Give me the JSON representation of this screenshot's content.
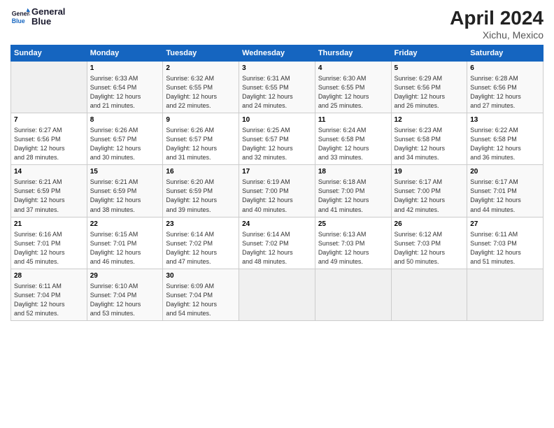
{
  "header": {
    "logo_line1": "General",
    "logo_line2": "Blue",
    "title": "April 2024",
    "subtitle": "Xichu, Mexico"
  },
  "columns": [
    "Sunday",
    "Monday",
    "Tuesday",
    "Wednesday",
    "Thursday",
    "Friday",
    "Saturday"
  ],
  "weeks": [
    [
      {
        "day": "",
        "info": ""
      },
      {
        "day": "1",
        "info": "Sunrise: 6:33 AM\nSunset: 6:54 PM\nDaylight: 12 hours\nand 21 minutes."
      },
      {
        "day": "2",
        "info": "Sunrise: 6:32 AM\nSunset: 6:55 PM\nDaylight: 12 hours\nand 22 minutes."
      },
      {
        "day": "3",
        "info": "Sunrise: 6:31 AM\nSunset: 6:55 PM\nDaylight: 12 hours\nand 24 minutes."
      },
      {
        "day": "4",
        "info": "Sunrise: 6:30 AM\nSunset: 6:55 PM\nDaylight: 12 hours\nand 25 minutes."
      },
      {
        "day": "5",
        "info": "Sunrise: 6:29 AM\nSunset: 6:56 PM\nDaylight: 12 hours\nand 26 minutes."
      },
      {
        "day": "6",
        "info": "Sunrise: 6:28 AM\nSunset: 6:56 PM\nDaylight: 12 hours\nand 27 minutes."
      }
    ],
    [
      {
        "day": "7",
        "info": "Sunrise: 6:27 AM\nSunset: 6:56 PM\nDaylight: 12 hours\nand 28 minutes."
      },
      {
        "day": "8",
        "info": "Sunrise: 6:26 AM\nSunset: 6:57 PM\nDaylight: 12 hours\nand 30 minutes."
      },
      {
        "day": "9",
        "info": "Sunrise: 6:26 AM\nSunset: 6:57 PM\nDaylight: 12 hours\nand 31 minutes."
      },
      {
        "day": "10",
        "info": "Sunrise: 6:25 AM\nSunset: 6:57 PM\nDaylight: 12 hours\nand 32 minutes."
      },
      {
        "day": "11",
        "info": "Sunrise: 6:24 AM\nSunset: 6:58 PM\nDaylight: 12 hours\nand 33 minutes."
      },
      {
        "day": "12",
        "info": "Sunrise: 6:23 AM\nSunset: 6:58 PM\nDaylight: 12 hours\nand 34 minutes."
      },
      {
        "day": "13",
        "info": "Sunrise: 6:22 AM\nSunset: 6:58 PM\nDaylight: 12 hours\nand 36 minutes."
      }
    ],
    [
      {
        "day": "14",
        "info": "Sunrise: 6:21 AM\nSunset: 6:59 PM\nDaylight: 12 hours\nand 37 minutes."
      },
      {
        "day": "15",
        "info": "Sunrise: 6:21 AM\nSunset: 6:59 PM\nDaylight: 12 hours\nand 38 minutes."
      },
      {
        "day": "16",
        "info": "Sunrise: 6:20 AM\nSunset: 6:59 PM\nDaylight: 12 hours\nand 39 minutes."
      },
      {
        "day": "17",
        "info": "Sunrise: 6:19 AM\nSunset: 7:00 PM\nDaylight: 12 hours\nand 40 minutes."
      },
      {
        "day": "18",
        "info": "Sunrise: 6:18 AM\nSunset: 7:00 PM\nDaylight: 12 hours\nand 41 minutes."
      },
      {
        "day": "19",
        "info": "Sunrise: 6:17 AM\nSunset: 7:00 PM\nDaylight: 12 hours\nand 42 minutes."
      },
      {
        "day": "20",
        "info": "Sunrise: 6:17 AM\nSunset: 7:01 PM\nDaylight: 12 hours\nand 44 minutes."
      }
    ],
    [
      {
        "day": "21",
        "info": "Sunrise: 6:16 AM\nSunset: 7:01 PM\nDaylight: 12 hours\nand 45 minutes."
      },
      {
        "day": "22",
        "info": "Sunrise: 6:15 AM\nSunset: 7:01 PM\nDaylight: 12 hours\nand 46 minutes."
      },
      {
        "day": "23",
        "info": "Sunrise: 6:14 AM\nSunset: 7:02 PM\nDaylight: 12 hours\nand 47 minutes."
      },
      {
        "day": "24",
        "info": "Sunrise: 6:14 AM\nSunset: 7:02 PM\nDaylight: 12 hours\nand 48 minutes."
      },
      {
        "day": "25",
        "info": "Sunrise: 6:13 AM\nSunset: 7:03 PM\nDaylight: 12 hours\nand 49 minutes."
      },
      {
        "day": "26",
        "info": "Sunrise: 6:12 AM\nSunset: 7:03 PM\nDaylight: 12 hours\nand 50 minutes."
      },
      {
        "day": "27",
        "info": "Sunrise: 6:11 AM\nSunset: 7:03 PM\nDaylight: 12 hours\nand 51 minutes."
      }
    ],
    [
      {
        "day": "28",
        "info": "Sunrise: 6:11 AM\nSunset: 7:04 PM\nDaylight: 12 hours\nand 52 minutes."
      },
      {
        "day": "29",
        "info": "Sunrise: 6:10 AM\nSunset: 7:04 PM\nDaylight: 12 hours\nand 53 minutes."
      },
      {
        "day": "30",
        "info": "Sunrise: 6:09 AM\nSunset: 7:04 PM\nDaylight: 12 hours\nand 54 minutes."
      },
      {
        "day": "",
        "info": ""
      },
      {
        "day": "",
        "info": ""
      },
      {
        "day": "",
        "info": ""
      },
      {
        "day": "",
        "info": ""
      }
    ]
  ]
}
